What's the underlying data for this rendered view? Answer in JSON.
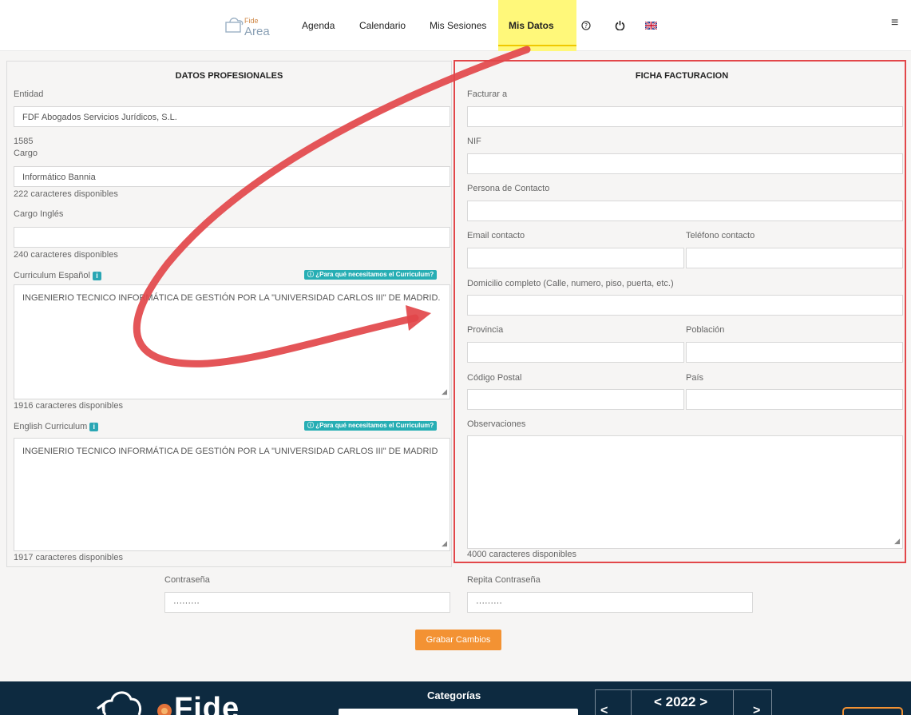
{
  "nav": {
    "logo_top": "Fide",
    "logo_bottom": "Area",
    "items": [
      "Agenda",
      "Calendario",
      "Mis Sesiones",
      "Mis Datos"
    ],
    "help_icon": "help-circle-icon",
    "power_icon": "power-icon",
    "flag_icon": "uk-flag-icon",
    "menu_icon": "hamburger-menu-icon"
  },
  "left": {
    "title": "DATOS PROFESIONALES",
    "entidad_label": "Entidad",
    "entidad_value": "FDF Abogados Servicios Jurídicos, S.L.",
    "entidad_code": "1585",
    "cargo_label": "Cargo",
    "cargo_value": "Informático Bannia",
    "cargo_counter": "222 caracteres disponibles",
    "cargo_en_label": "Cargo Inglés",
    "cargo_en_value": "",
    "cargo_en_counter": "240 caracteres disponibles",
    "cv_es_label": "Curriculum Español",
    "cv_help": "¿Para qué necesitamos el Curriculum?",
    "cv_es_value": "INGENIERIO TECNICO INFORMÁTICA DE GESTIÓN POR LA \"UNIVERSIDAD CARLOS III\" DE MADRID.",
    "cv_es_counter": "1916 caracteres disponibles",
    "cv_en_label": "English Curriculum",
    "cv_en_value": "INGENIERIO TECNICO INFORMÁTICA DE GESTIÓN POR LA \"UNIVERSIDAD CARLOS III\" DE MADRID",
    "cv_en_counter": "1917 caracteres disponibles"
  },
  "right": {
    "title": "FICHA FACTURACION",
    "facturar_label": "Facturar a",
    "nif_label": "NIF",
    "contacto_label": "Persona de Contacto",
    "email_label": "Email contacto",
    "telefono_label": "Teléfono contacto",
    "domicilio_label": "Domicilio completo (Calle, numero, piso, puerta, etc.)",
    "provincia_label": "Provincia",
    "poblacion_label": "Población",
    "cp_label": "Código Postal",
    "pais_label": "País",
    "obs_label": "Observaciones",
    "obs_counter": "4000 caracteres disponibles"
  },
  "password": {
    "label": "Contraseña",
    "value": "·········",
    "repeat_label": "Repita Contraseña",
    "repeat_value": "·········"
  },
  "save_button": "Grabar Cambios",
  "footer": {
    "categorias": "Categorías",
    "year": "< 2022 >",
    "brand": "Fide",
    "prev": "<",
    "next": ">"
  },
  "colors": {
    "highlight": "#fff87a",
    "annotation_red": "#e2474a",
    "accent_orange": "#f39233",
    "help_teal": "#27aeb4",
    "footer_bg": "#0d2a40"
  }
}
